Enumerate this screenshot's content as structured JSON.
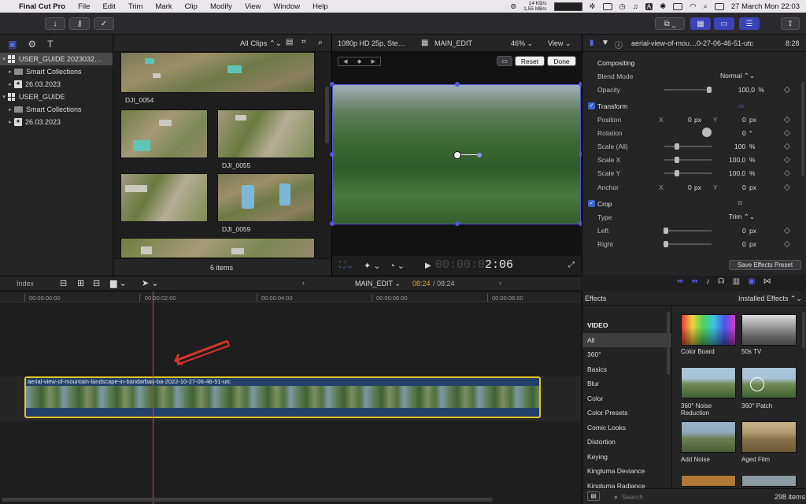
{
  "menubar": {
    "apple": "",
    "app_name": "Final Cut Pro",
    "items": [
      "File",
      "Edit",
      "Trim",
      "Mark",
      "Clip",
      "Modify",
      "View",
      "Window",
      "Help"
    ],
    "net_up": "14 KB/s",
    "net_down": "1,55 MB/s",
    "clock": "27 March Mon  22:03"
  },
  "sidebar": {
    "items": [
      {
        "label": "USER_GUIDE 2023032…",
        "type": "library",
        "selected": true
      },
      {
        "label": "Smart Collections",
        "type": "folder"
      },
      {
        "label": "26.03.2023",
        "type": "event"
      },
      {
        "label": "USER_GUIDE",
        "type": "library"
      },
      {
        "label": "Smart Collections",
        "type": "folder"
      },
      {
        "label": "26.03.2023",
        "type": "event"
      }
    ]
  },
  "browser": {
    "filter": "All Clips",
    "clips": [
      "DJI_0054",
      "DJI_0055",
      "DJI_0059"
    ],
    "count": "6 items"
  },
  "viewer": {
    "format": "1080p HD 25p, Ste…",
    "project": "MAIN_EDIT",
    "zoom": "46%",
    "view": "View",
    "reset": "Reset",
    "done": "Done",
    "timecode_dim": "00:00:0",
    "timecode": "2:06"
  },
  "inspector": {
    "clip_title": "aerial-view-of-mou…0-27-06-46-51-utc",
    "duration": "8:28",
    "compositing": "Compositing",
    "blend_mode_label": "Blend Mode",
    "blend_mode": "Normal",
    "opacity_label": "Opacity",
    "opacity": "100,0",
    "opacity_unit": "%",
    "transform": "Transform",
    "position_label": "Position",
    "x": "X",
    "y": "Y",
    "position_x": "0",
    "position_y": "0",
    "px": "px",
    "rotation_label": "Rotation",
    "rotation": "0",
    "deg": "°",
    "scale_all_label": "Scale (All)",
    "scale_all": "100",
    "scale_x_label": "Scale X",
    "scale_x": "100,0",
    "scale_y_label": "Scale Y",
    "scale_y": "100,0",
    "anchor_label": "Anchor",
    "anchor_x": "0",
    "anchor_y": "0",
    "crop": "Crop",
    "type_label": "Type",
    "type": "Trim",
    "left_label": "Left",
    "left": "0",
    "right_label": "Right",
    "right": "0",
    "save_preset": "Save Effects Preset"
  },
  "timeline": {
    "index": "Index",
    "project": "MAIN_EDIT",
    "position": "08:24",
    "total": "/ 08:24",
    "ticks": [
      "00:00:00:00",
      "00:00:02:00",
      "00:00:04:00",
      "00:00:06:00",
      "00:00:08:00"
    ],
    "clip_name": "aerial-view-of-mountain-landscape-in-bandarban-ba-2022-10-27-06-46-51-utc"
  },
  "effects": {
    "title": "Effects",
    "installed": "Installed Effects",
    "categories": [
      "VIDEO",
      "All",
      "360°",
      "Basics",
      "Blur",
      "Color",
      "Color Presets",
      "Comic Looks",
      "Distortion",
      "Keying",
      "Kingluma Deviance",
      "Kingluma Radiance"
    ],
    "items": [
      "Color Board",
      "50s TV",
      "360° Noise Reduction",
      "360° Patch",
      "Add Noise",
      "Aged Film"
    ],
    "search_placeholder": "Search",
    "count": "298 items"
  },
  "colors": {
    "accent": "#5058d8",
    "clip_border": "#e5c220",
    "playhead": "#d54a2a",
    "timecode": "#e5a32b"
  }
}
